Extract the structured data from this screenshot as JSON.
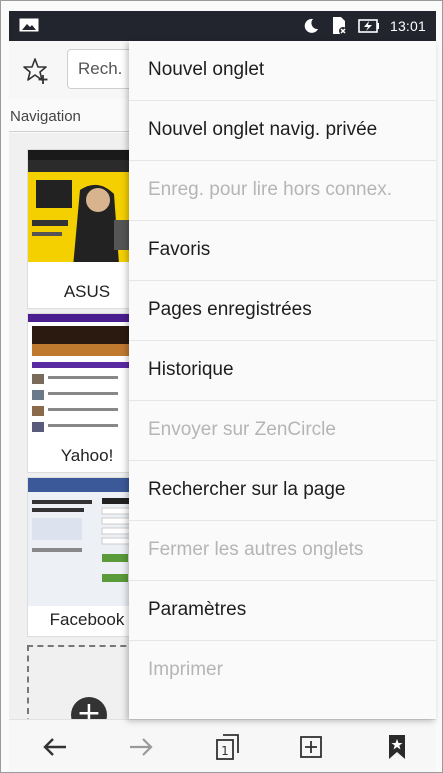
{
  "status_bar": {
    "time": "13:01",
    "icons": [
      "image-notification-icon",
      "moon-icon",
      "sim-card-icon",
      "battery-charging-icon"
    ]
  },
  "toolbar": {
    "search_placeholder": "Rech."
  },
  "tabs": {
    "navigation_label": "Navigation"
  },
  "thumbnails": [
    {
      "caption": "ASUS"
    },
    {
      "caption": "Yahoo!"
    },
    {
      "caption": "Facebook"
    }
  ],
  "menu": {
    "items": [
      {
        "label": "Nouvel onglet",
        "enabled": true
      },
      {
        "label": "Nouvel onglet navig. privée",
        "enabled": true
      },
      {
        "label": "Enreg. pour lire hors connex.",
        "enabled": false
      },
      {
        "label": "Favoris",
        "enabled": true
      },
      {
        "label": "Pages enregistrées",
        "enabled": true
      },
      {
        "label": "Historique",
        "enabled": true
      },
      {
        "label": "Envoyer sur ZenCircle",
        "enabled": false
      },
      {
        "label": "Rechercher sur la page",
        "enabled": true
      },
      {
        "label": "Fermer les autres onglets",
        "enabled": false
      },
      {
        "label": "Paramètres",
        "enabled": true
      },
      {
        "label": "Imprimer",
        "enabled": false
      }
    ]
  },
  "bottom_bar": {
    "tab_count": "1"
  },
  "colors": {
    "status_bar": "#22252e",
    "menu_bg": "#fafafa",
    "disabled_text": "#b5b5b5"
  }
}
